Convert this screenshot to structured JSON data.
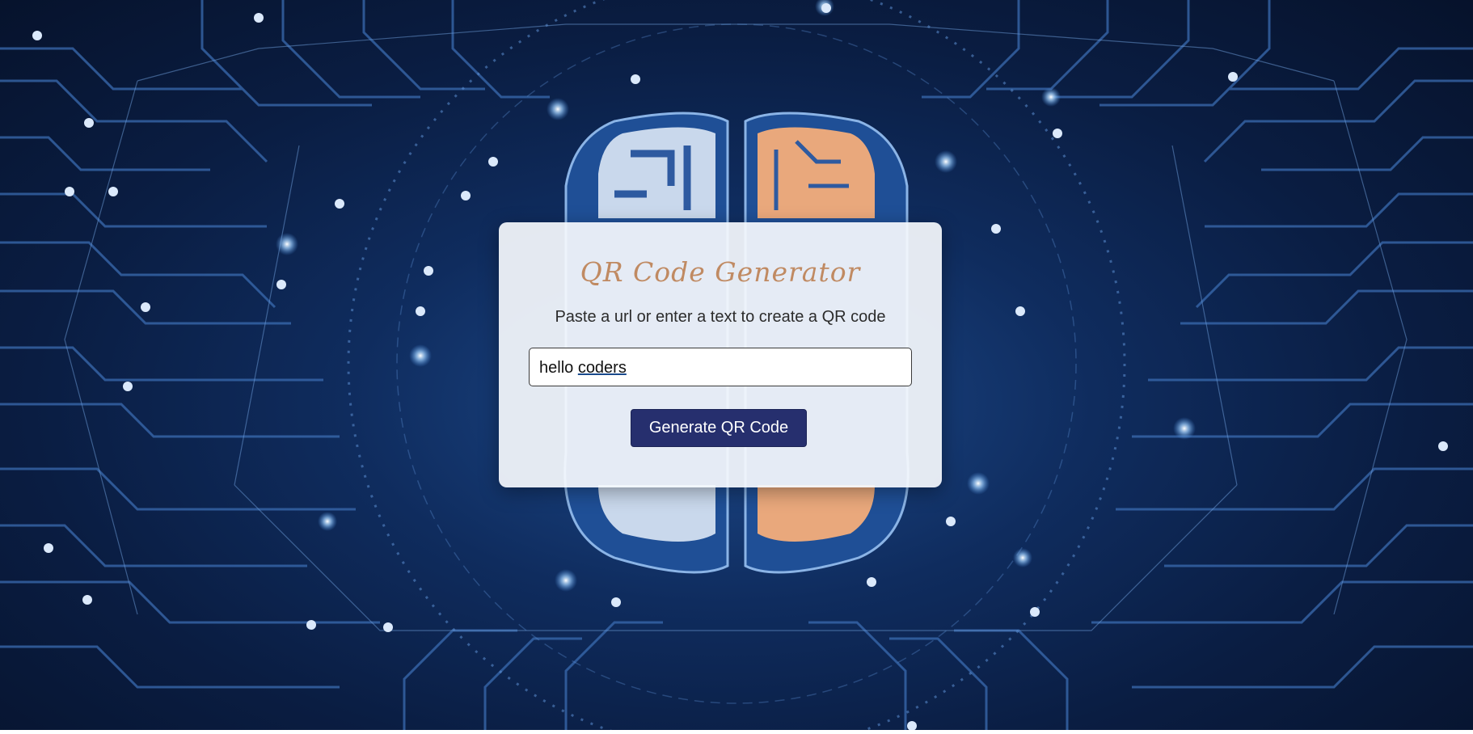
{
  "app": {
    "title": "QR Code Generator",
    "subtitle": "Paste a url or enter a text to create a QR code"
  },
  "input": {
    "value_word1": "hello ",
    "value_word2": "coders",
    "value": "hello coders"
  },
  "button": {
    "label": "Generate QR Code"
  },
  "colors": {
    "title": "#c08a62",
    "button_bg": "#262f6e",
    "background": "#0f2c5e",
    "brain_left": "#c9d8ec",
    "brain_right": "#e9a87c"
  },
  "background": {
    "icon": "circuit-brain-icon"
  }
}
